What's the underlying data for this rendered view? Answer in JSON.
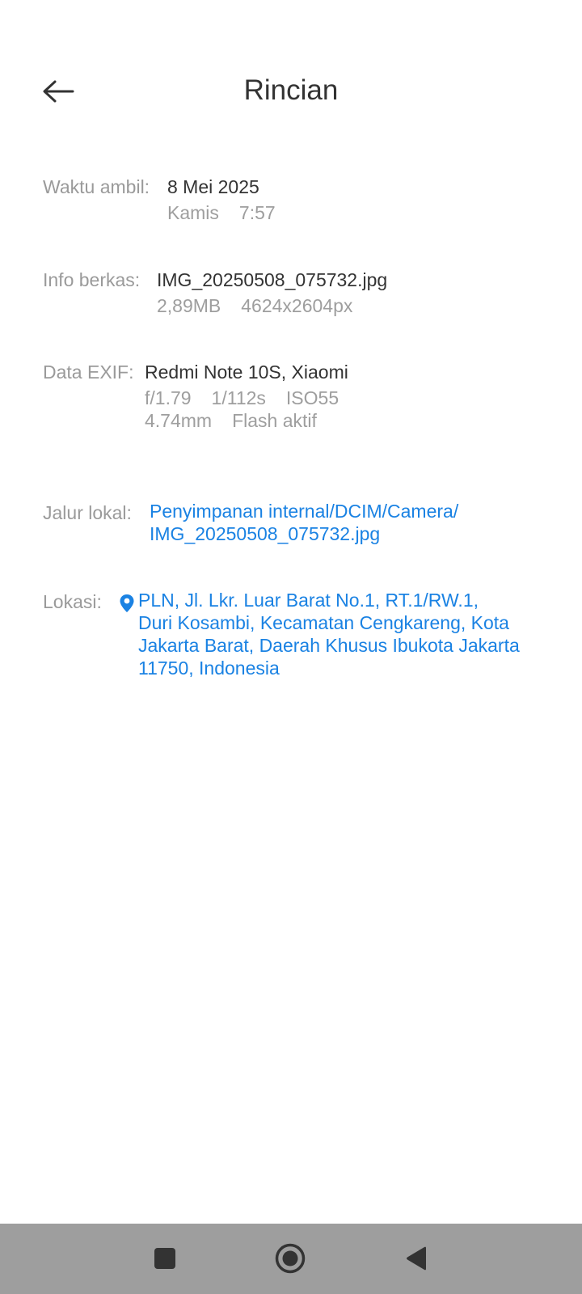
{
  "header": {
    "title": "Rincian"
  },
  "details": {
    "time": {
      "label": "Waktu ambil:",
      "date": "8 Mei 2025",
      "day": "Kamis",
      "clock": "7:57"
    },
    "file": {
      "label": "Info berkas:",
      "name": "IMG_20250508_075732.jpg",
      "size": "2,89MB",
      "resolution": "4624x2604px"
    },
    "exif": {
      "label": "Data EXIF:",
      "device": "Redmi Note 10S, Xiaomi",
      "aperture": "f/1.79",
      "shutter": "1/112s",
      "iso": "ISO55",
      "focal": "4.74mm",
      "flash": "Flash aktif"
    },
    "path": {
      "label": "Jalur lokal:",
      "line1": "Penyimpanan internal/DCIM/Camera/",
      "line2": "IMG_20250508_075732.jpg"
    },
    "location": {
      "label": "Lokasi:",
      "line1": "PLN, Jl. Lkr. Luar Barat No.1, RT.1/RW.1,",
      "line2": "Duri Kosambi, Kecamatan Cengkareng, Kota",
      "line3": "Jakarta Barat, Daerah Khusus Ibukota Jakarta",
      "line4": "11750, Indonesia"
    }
  },
  "icons": {
    "back": "back-arrow-icon",
    "location": "location-pin-icon",
    "recents": "square-icon",
    "home": "circle-icon",
    "nav_back": "triangle-back-icon"
  },
  "colors": {
    "link": "#1a82e3",
    "navbar": "#9e9e9e"
  }
}
